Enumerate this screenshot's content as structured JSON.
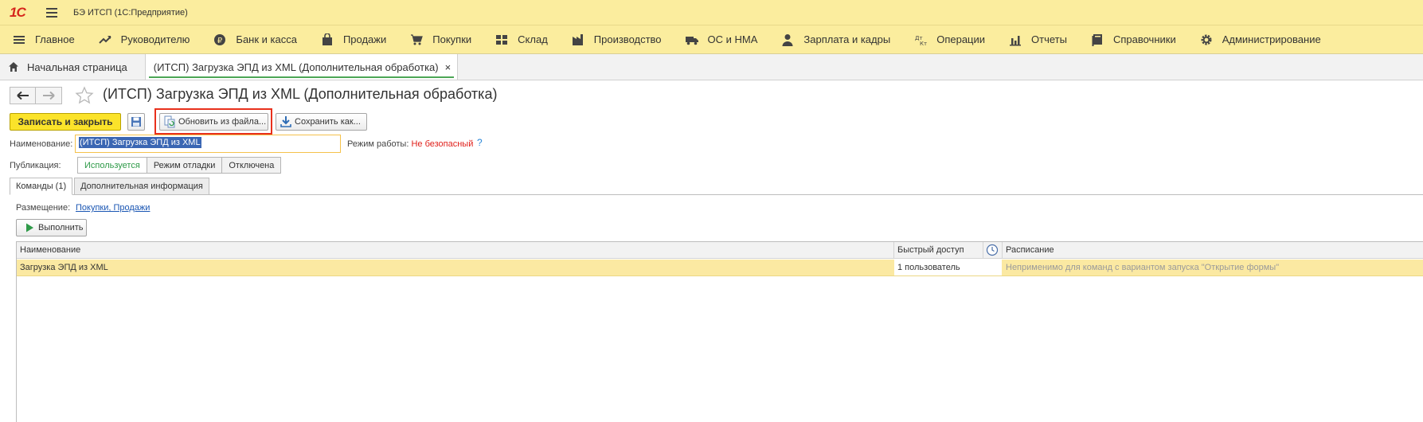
{
  "app": {
    "logo_text": "1С",
    "title": "БЭ ИТСП  (1С:Предприятие)"
  },
  "sections": [
    {
      "label": "Главное",
      "icon": "menu-icon"
    },
    {
      "label": "Руководителю",
      "icon": "trend-icon"
    },
    {
      "label": "Банк и касса",
      "icon": "coin-icon"
    },
    {
      "label": "Продажи",
      "icon": "bag-icon"
    },
    {
      "label": "Покупки",
      "icon": "cart-icon"
    },
    {
      "label": "Склад",
      "icon": "warehouse-icon"
    },
    {
      "label": "Производство",
      "icon": "factory-icon"
    },
    {
      "label": "ОС и НМА",
      "icon": "truck-icon"
    },
    {
      "label": "Зарплата и кадры",
      "icon": "person-icon"
    },
    {
      "label": "Операции",
      "icon": "dt-kt-icon"
    },
    {
      "label": "Отчеты",
      "icon": "bar-chart-icon"
    },
    {
      "label": "Справочники",
      "icon": "book-icon"
    },
    {
      "label": "Администрирование",
      "icon": "gear-icon"
    }
  ],
  "tabs": {
    "home": "Начальная страница",
    "current": "(ИТСП) Загрузка ЭПД из XML (Дополнительная обработка)",
    "close": "×"
  },
  "form": {
    "title": "(ИТСП) Загрузка ЭПД из XML (Дополнительная обработка)",
    "buttons": {
      "save_close": "Записать и закрыть",
      "refresh": "Обновить из файла...",
      "save_as": "Сохранить как..."
    },
    "name_label": "Наименование:",
    "name_value": "(ИТСП) Загрузка ЭПД из XML",
    "mode_label": "Режим работы:",
    "mode_value": "Не безопасный",
    "help": "?",
    "publication_label": "Публикация:",
    "publication_options": [
      "Используется",
      "Режим отладки",
      "Отключена"
    ],
    "publication_selected": "Используется"
  },
  "inner_tabs": [
    "Команды (1)",
    "Дополнительная информация"
  ],
  "commands": {
    "placement_label": "Размещение:",
    "placement_value": "Покупки, Продажи",
    "run_label": "Выполнить",
    "table": {
      "columns": [
        "Наименование",
        "Быстрый доступ",
        "Расписание"
      ],
      "rows": [
        [
          "Загрузка ЭПД из XML",
          "1 пользователь",
          "Неприменимо для команд с вариантом запуска \"Открытие формы\""
        ]
      ]
    }
  },
  "colors": {
    "panel_yellow": "#fbed9e",
    "primary_button": "#fbe32a",
    "selected_row": "#fbe9a2",
    "active_green": "#2e9a48",
    "danger_red": "#e0201b",
    "highlight_red": "#e8301c"
  }
}
